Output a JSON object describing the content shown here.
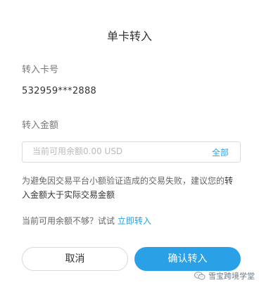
{
  "dialog": {
    "title": "单卡转入",
    "card_label": "转入卡号",
    "card_number": "532959***2888",
    "amount_label": "转入金额",
    "amount_placeholder": "当前可用余额0.00 USD",
    "amount_value": "",
    "all_label": "全部",
    "notice_text_1": "为避免因交易平台小额验证造成的交易失败，建议您的",
    "notice_strong": "转入金额大于实际交易金额",
    "hint_text": "当前可用余额不够？试试",
    "hint_link": "立即转入",
    "cancel_label": "取消",
    "confirm_label": "确认转入"
  },
  "watermark": {
    "text": "雪宝跨境学堂",
    "icon": "wechat-icon"
  },
  "colors": {
    "accent": "#2aa0e6",
    "text_primary": "#333333",
    "text_secondary": "#777777",
    "border": "#dcdcdc"
  }
}
